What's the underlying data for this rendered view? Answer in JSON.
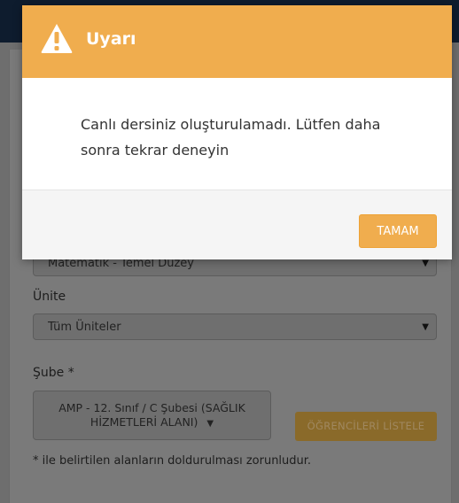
{
  "modal": {
    "title": "Uyarı",
    "icon": "warning-icon",
    "message": "Canlı dersiniz oluşturulamadı. Lütfen daha sonra tekrar deneyin",
    "ok_label": "TAMAM",
    "accent_color": "#f0ad4e"
  },
  "form": {
    "course_select_value": "Matematik - Temel Düzey",
    "unit_label": "Ünite",
    "unit_select_value": "Tüm Üniteler",
    "branch_label": "Şube *",
    "branch_select_line1": "AMP - 12. Sınıf / C Şubesi (SAĞLIK",
    "branch_select_line2": "HİZMETLERİ ALANI)",
    "list_students_label": "ÖĞRENCİLERİ LİSTELE",
    "required_note": "* ile belirtilen alanların doldurulması zorunludur."
  }
}
